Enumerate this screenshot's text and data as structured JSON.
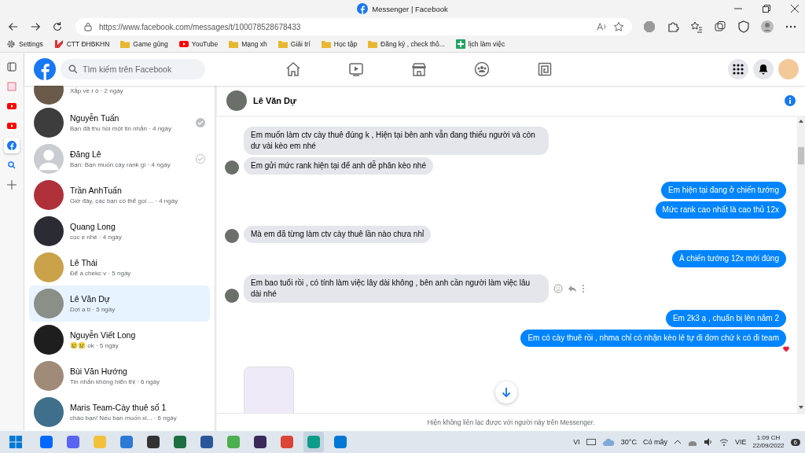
{
  "window": {
    "title": "Messenger | Facebook"
  },
  "address_bar": {
    "url": "https://www.facebook.com/messages/t/100078528678433"
  },
  "bookmarks": [
    {
      "label": "Settings",
      "kind": "gear"
    },
    {
      "label": "CTT ĐHBKHN",
      "kind": "site"
    },
    {
      "label": "Game gủng",
      "kind": "folder"
    },
    {
      "label": "YouTube",
      "kind": "youtube"
    },
    {
      "label": "Mạng xh",
      "kind": "folder"
    },
    {
      "label": "Giải trí",
      "kind": "folder"
    },
    {
      "label": "Học tập",
      "kind": "folder"
    },
    {
      "label": "Đăng ký , check thô...",
      "kind": "folder"
    },
    {
      "label": "lịch làm việc",
      "kind": "sheet"
    }
  ],
  "edge_sidebar": [
    {
      "kind": "tabs",
      "selected": false
    },
    {
      "kind": "app",
      "selected": false
    },
    {
      "kind": "youtube",
      "selected": false
    },
    {
      "kind": "youtube",
      "selected": false
    },
    {
      "kind": "facebook",
      "selected": true
    },
    {
      "kind": "search",
      "selected": false
    },
    {
      "kind": "add",
      "selected": false
    }
  ],
  "search": {
    "placeholder": "Tìm kiếm trên Facebook"
  },
  "nav_tabs": [
    {
      "kind": "home"
    },
    {
      "kind": "video"
    },
    {
      "kind": "store"
    },
    {
      "kind": "groups"
    },
    {
      "kind": "gaming"
    }
  ],
  "conversations": [
    {
      "snippet": "Xắp về r ô · 2 ngày",
      "selected": false
    },
    {
      "name": "Nguyễn Tuấn",
      "snippet": "Bạn đã thu hồi một tin nhắn · 4 ngày",
      "selected": false,
      "sent": true,
      "delivered": true
    },
    {
      "name": "Đăng Lê",
      "snippet": "Bạn: Bạn muốn cày rank gì · 4 ngày",
      "selected": false,
      "sent": true,
      "delivered": false,
      "no_photo": true
    },
    {
      "name": "Trần AnhTuấn",
      "snippet": "Giờ đây, các bạn có thể gọi ... · 4 ngày",
      "selected": false
    },
    {
      "name": "Quang Long",
      "snippet": "cọc e nhé · 4 ngày",
      "selected": false
    },
    {
      "name": "Lê Thái",
      "snippet": "Để a chekc v · 5 ngày",
      "selected": false
    },
    {
      "name": "Lê Văn Dự",
      "snippet": "Dợi a tí · 5 ngày",
      "selected": true
    },
    {
      "name": "Nguyễn Viết Long",
      "snippet": "😢😢 ok · 5 ngày",
      "selected": false
    },
    {
      "name": "Bùi Văn Hướng",
      "snippet": "Tin nhắn không hiển thị · 6 ngày",
      "selected": false
    },
    {
      "name": "Maris Team-Cày thuê số 1",
      "snippet": "chào bạn! Nếu bạn muốn xi... · 6 ngày",
      "selected": false
    }
  ],
  "chat": {
    "name": "Lê Văn Dự",
    "messages": [
      {
        "kind": "incoming",
        "text": "Em muốn làm ctv cày thuê đúng k ,   Hiện tại bên anh vẫn đang thiếu người và còn dư vài kèo em nhé",
        "avatar": false,
        "reacted": false,
        "hovered": false
      },
      {
        "kind": "incoming",
        "text": "Em gửi mức rank hiện tại để anh dễ phân kèo nhé",
        "avatar": true,
        "reacted": false,
        "hovered": false
      },
      {
        "kind": "outgoing",
        "text": "Em hiện tại đang ở chiến tướng",
        "avatar": false,
        "reacted": false,
        "hovered": false
      },
      {
        "kind": "outgoing",
        "text": "Mức rank cao nhất là cao thủ 12x",
        "avatar": false,
        "reacted": false,
        "hovered": false
      },
      {
        "kind": "incoming",
        "text": "Mà em đã từng làm ctv cày thuê lần nào chưa nhỉ",
        "avatar": true,
        "reacted": false,
        "hovered": false
      },
      {
        "kind": "outgoing",
        "text": "À chiến tướng 12x mới đúng",
        "avatar": false,
        "reacted": false,
        "hovered": false
      },
      {
        "kind": "incoming",
        "text": "Em bao tuổi rồi , có tính làm việc lây dài  không , bên anh cần người làm việc lâu  dài nhé",
        "avatar": true,
        "reacted": false,
        "hovered": true
      },
      {
        "kind": "outgoing",
        "text": "Em 2k3 ạ , chuẩn bị lên năm 2",
        "avatar": false,
        "reacted": false,
        "hovered": false
      },
      {
        "kind": "outgoing",
        "text": "Em có cày thuê rồi , nhma chỉ có nhận kèo lẻ tự đi đơn chứ k có đi team",
        "avatar": false,
        "reacted": true,
        "hovered": false
      },
      {
        "kind": "image",
        "avatar": false,
        "reacted": false,
        "hovered": false
      }
    ],
    "footer": "Hiện không liên lạc được với người này trên Messenger."
  },
  "taskbar": {
    "apps": [
      {
        "kind": "zalo",
        "selected": false
      },
      {
        "kind": "discord",
        "selected": false
      },
      {
        "kind": "folder",
        "selected": false
      },
      {
        "kind": "store",
        "selected": false
      },
      {
        "kind": "dell",
        "selected": false
      },
      {
        "kind": "excel",
        "selected": false
      },
      {
        "kind": "word",
        "selected": false
      },
      {
        "kind": "green",
        "selected": false
      },
      {
        "kind": "nox",
        "selected": false
      },
      {
        "kind": "chrome",
        "selected": false
      },
      {
        "kind": "edge",
        "selected": true
      },
      {
        "kind": "mail",
        "selected": false
      }
    ],
    "ime": "VI",
    "temperature": "30°C",
    "weather": "Có mây",
    "language": "VIE",
    "time": "1:09 CH",
    "date": "22/09/2022",
    "notifications": "6"
  }
}
